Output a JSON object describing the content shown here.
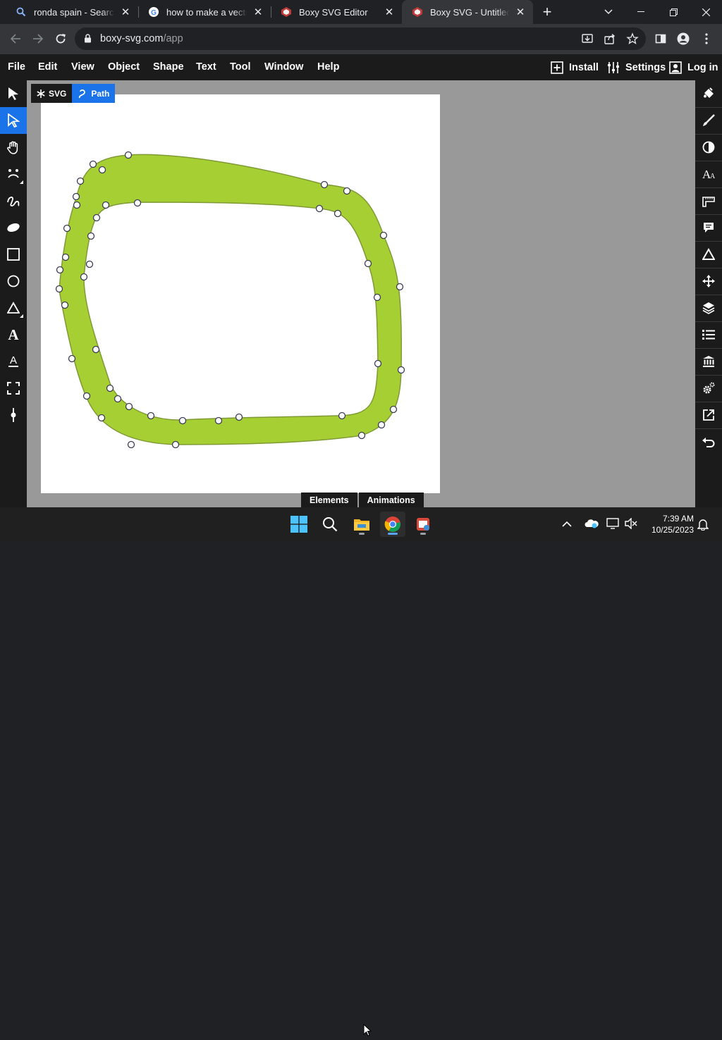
{
  "browser": {
    "tabs": [
      {
        "title": "ronda spain - Search",
        "icon": "search-icon"
      },
      {
        "title": "how to make a vector in",
        "icon": "google-icon"
      },
      {
        "title": "Boxy SVG Editor",
        "icon": "boxy-icon"
      },
      {
        "title": "Boxy SVG - Untitled [Ed",
        "icon": "boxy-icon",
        "active": true
      }
    ],
    "new_tab": "+",
    "url_host": "boxy-svg.com",
    "url_path": "/app"
  },
  "app": {
    "menu": [
      "File",
      "Edit",
      "View",
      "Object",
      "Shape",
      "Text",
      "Tool",
      "Window",
      "Help"
    ],
    "install_label": "Install",
    "settings_label": "Settings",
    "login_label": "Log in",
    "breadcrumb": {
      "root": "SVG",
      "current": "Path"
    },
    "bottom_tabs": [
      "Elements",
      "Animations"
    ],
    "accent": "#1a73e8",
    "shape_fill": "#a6cf33",
    "shape_stroke": "#7f9a35"
  },
  "tools_left": [
    "pointer-icon",
    "edit-node-icon",
    "hand-icon",
    "face-icon",
    "freehand-icon",
    "ellipse-brush-icon",
    "rectangle-icon",
    "circle-icon",
    "triangle-icon",
    "text-icon",
    "text-path-icon",
    "crop-icon",
    "pen-icon"
  ],
  "tools_right": [
    "fill-icon",
    "stroke-brush-icon",
    "contrast-icon",
    "font-icon",
    "ruler-icon",
    "comment-icon",
    "triangle-outline-icon",
    "move-icon",
    "layers-icon",
    "list-icon",
    "library-icon",
    "settings-gear-icon",
    "export-icon",
    "undo-icon"
  ],
  "taskbar": {
    "time": "7:39 AM",
    "date": "10/25/2023"
  }
}
